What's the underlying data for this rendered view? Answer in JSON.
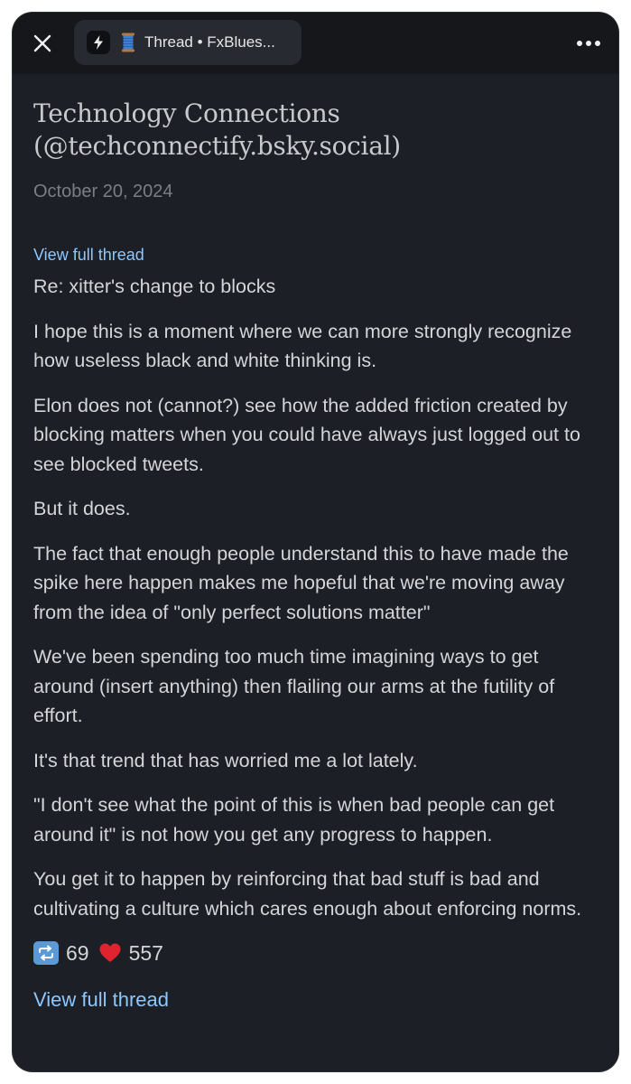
{
  "tab": {
    "title": "Thread • FxBlues..."
  },
  "post": {
    "author": "Technology Connections (@techconnectify.bsky.social)",
    "date": "October 20, 2024",
    "view_thread_top": "View full thread",
    "paragraphs": [
      "Re: xitter's change to blocks",
      "I hope this is a moment where we can more strongly recognize how useless black and white thinking is.",
      "Elon does not (cannot?) see how the added friction created by blocking matters when you could have always just logged out to see blocked tweets.",
      "But it does.",
      "The fact that enough people understand this to have made the spike here happen makes me hopeful that we're moving away from the idea of \"only perfect solutions matter\"",
      "We've been spending too much time imagining ways to get around (insert anything) then flailing our arms at the futility of effort.",
      "It's that trend that has worried me a lot lately.",
      "\"I don't see what the point of this is when bad people can get around it\" is not how you get any progress to happen.",
      "You get it to happen by reinforcing that bad stuff is bad and cultivating a culture which cares enough about enforcing norms."
    ],
    "reposts": "69",
    "likes": "557",
    "view_thread_bottom": "View full thread"
  },
  "icons": {
    "close": "close-icon",
    "bolt": "bolt-icon",
    "spool": "thread-spool-icon",
    "more": "more-icon",
    "repost": "repost-icon",
    "heart": "heart-icon"
  },
  "colors": {
    "background": "#1c1f26",
    "topbar": "#15171b",
    "link": "#8cc8ff",
    "text": "#d4d5d8",
    "muted": "#7b7e85",
    "heart": "#e0242f"
  }
}
